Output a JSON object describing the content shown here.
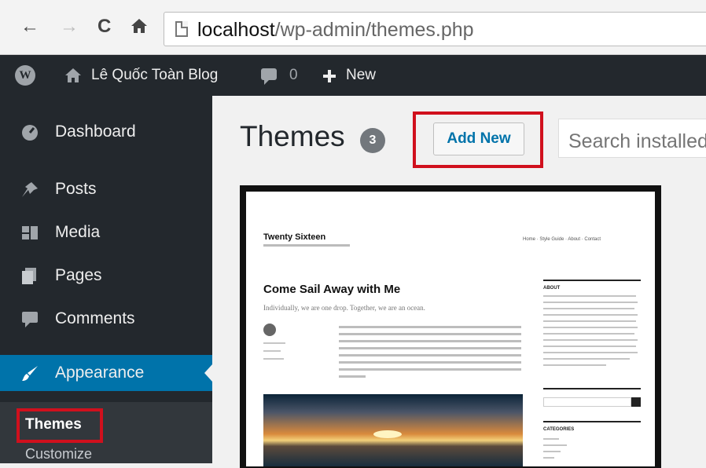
{
  "browser": {
    "url_host": "localhost",
    "url_path": "/wp-admin/themes.php",
    "back_icon": "←",
    "forward_icon": "→",
    "reload_icon": "C",
    "home_icon": "home-icon"
  },
  "adminbar": {
    "site_name": "Lê Quốc Toàn Blog",
    "comments_count": "0",
    "new_label": "New"
  },
  "sidebar": {
    "items": [
      {
        "label": "Dashboard",
        "icon": "dashboard-icon"
      },
      {
        "label": "Posts",
        "icon": "pin-icon"
      },
      {
        "label": "Media",
        "icon": "media-icon"
      },
      {
        "label": "Pages",
        "icon": "pages-icon"
      },
      {
        "label": "Comments",
        "icon": "comment-icon"
      },
      {
        "label": "Appearance",
        "icon": "brush-icon"
      }
    ],
    "submenu": {
      "themes": "Themes",
      "customize": "Customize"
    }
  },
  "main": {
    "title": "Themes",
    "count": "3",
    "add_new": "Add New",
    "search_placeholder": "Search installed"
  },
  "theme_preview": {
    "site_title": "Twenty Sixteen",
    "nav": "Home · Style Guide · About · Contact",
    "post_title": "Come Sail Away with Me",
    "lead": "Individually, we are one drop. Together, we are an ocean.",
    "widget_about": "ABOUT",
    "widget_categories": "CATEGORIES"
  },
  "colors": {
    "adminbar": "#23282d",
    "active": "#0073aa",
    "highlight": "#d0101d"
  }
}
